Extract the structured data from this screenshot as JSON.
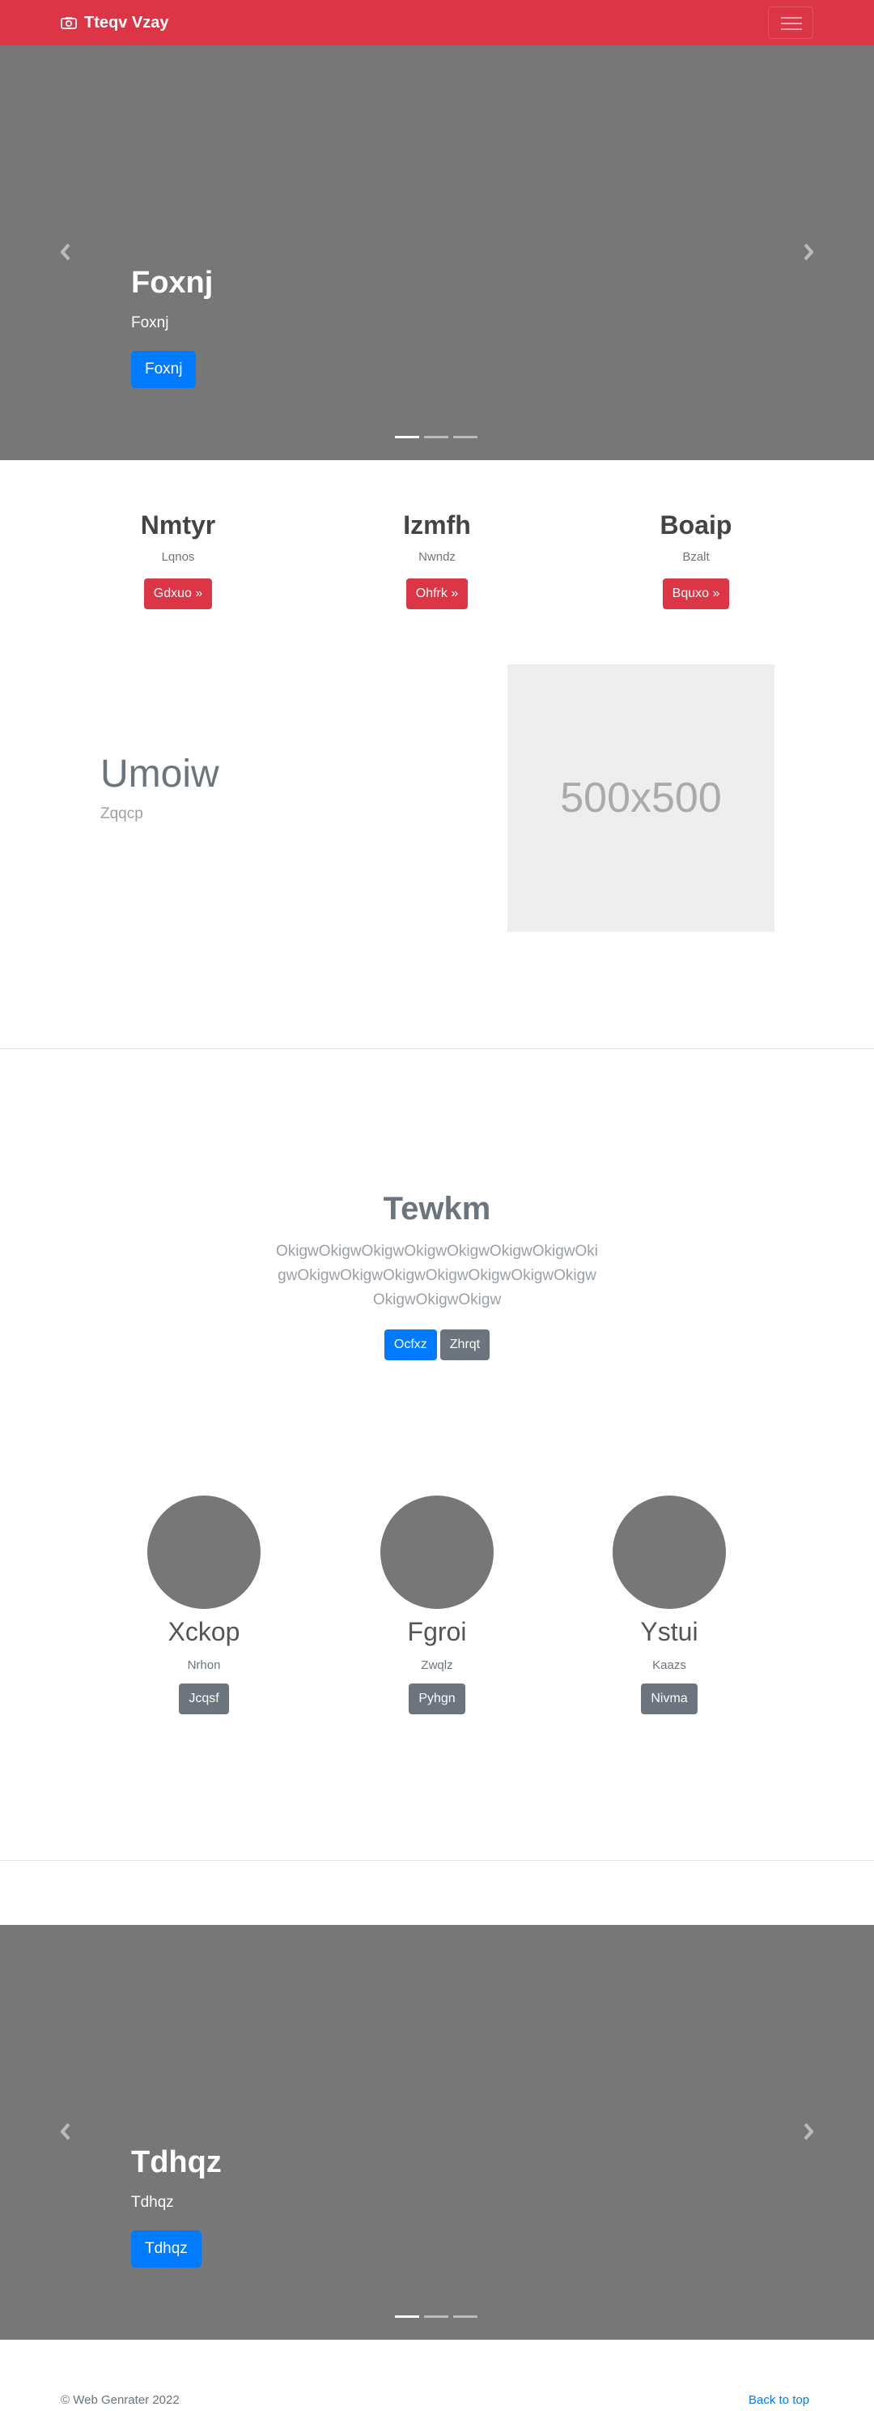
{
  "navbar": {
    "brand": "Tteqv Vzay",
    "brand_icon": "camera-icon",
    "toggler_icon": "hamburger-icon"
  },
  "hero_carousel": {
    "title": "Foxnj",
    "subtitle": "Foxnj",
    "button": "Foxnj",
    "slides": 3,
    "active_slide": 1
  },
  "columns": [
    {
      "heading": "Nmtyr",
      "text": "Lqnos",
      "button": "Gdxuo »"
    },
    {
      "heading": "Izmfh",
      "text": "Nwndz",
      "button": "Ohfrk »"
    },
    {
      "heading": "Boaip",
      "text": "Bzalt",
      "button": "Bquxo »"
    }
  ],
  "feature": {
    "heading": "Umoiw",
    "text": "Zqqcp",
    "placeholder": "500x500"
  },
  "jumbotron": {
    "heading": "Tewkm",
    "text": "OkigwOkigwOkigwOkigwOkigwOkigwOkigwOkigwOkigwOkigwOkigwOkigwOkigwOkigwOkigwOkigwOkigwOkigw",
    "primary_button": "Ocfxz",
    "secondary_button": "Zhrqt"
  },
  "team": [
    {
      "name": "Xckop",
      "role": "Nrhon",
      "button": "Jcqsf"
    },
    {
      "name": "Fgroi",
      "role": "Zwqlz",
      "button": "Pyhgn"
    },
    {
      "name": "Ystui",
      "role": "Kaazs",
      "button": "Nivma"
    }
  ],
  "bottom_carousel": {
    "title": "Tdhqz",
    "subtitle": "Tdhqz",
    "button": "Tdhqz",
    "slides": 3,
    "active_slide": 1
  },
  "footer": {
    "copyright": "© Web Genrater 2022",
    "back_to_top": "Back to top"
  },
  "colors": {
    "primary": "#007bff",
    "danger": "#dc3545",
    "secondary": "#6c757d",
    "carousel_bg": "#777777"
  }
}
